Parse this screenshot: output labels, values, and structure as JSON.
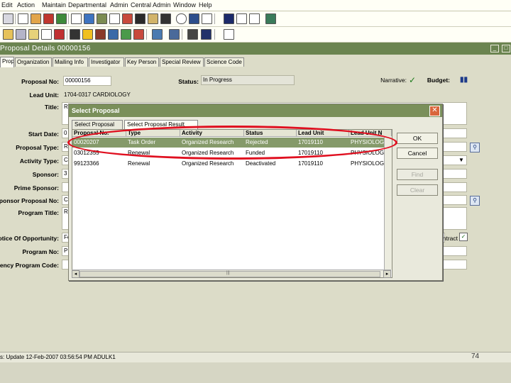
{
  "menu": [
    "Edit",
    "Action",
    "Maintain",
    "Departmental",
    "Admin",
    "Central Admin",
    "Window",
    "Help"
  ],
  "window": {
    "title": "Proposal Details  00000156"
  },
  "tabs": [
    "Proposal",
    "Organization",
    "Mailing Info",
    "Investigator",
    "Key Person",
    "Special Review",
    "Science Code"
  ],
  "form": {
    "proposal_no_label": "Proposal No:",
    "proposal_no": "00000156",
    "status_label": "Status:",
    "status": "In Progress",
    "narrative_label": "Narrative:",
    "budget_label": "Budget:",
    "lead_unit_label": "Lead Unit:",
    "lead_unit": "1704-0317 CARDIOLOGY",
    "title_label": "Title:",
    "title": "R",
    "start_date_label": "Start Date:",
    "start_date": "0",
    "proposal_type_label": "Proposal Type:",
    "proposal_type": "Ro",
    "activity_type_label": "Activity Type:",
    "activity_type": "Cl",
    "sponsor_label": "Sponsor:",
    "sponsor": "3",
    "prime_sponsor_label": "Prime Sponsor:",
    "sponsor_proposal_no_label": "Sponsor Proposal No:",
    "sponsor_proposal_no": "C",
    "program_title_label": "Program Title:",
    "program_title": "Re",
    "notice_label": "Notice Of Opportunity:",
    "notice": "Fe",
    "contract_label": "Contract",
    "program_no_label": "Program No:",
    "program_no": "P",
    "agency_code_label": "Agency Program Code:"
  },
  "dialog": {
    "title": "Select Proposal",
    "tabs": [
      "Select Proposal",
      "Select Proposal Result"
    ],
    "columns": [
      "Proposal No.",
      "Type",
      "Activity",
      "Status",
      "Lead Unit",
      "Lead Unit N"
    ],
    "rows": [
      [
        "00020207",
        "Task Order",
        "Organized Research",
        "Rejected",
        "17019110",
        "PHYSIOLOGY P"
      ],
      [
        "03012355",
        "Renewal",
        "Organized Research",
        "Funded",
        "17019110",
        "PHYSIOLOGY P"
      ],
      [
        "99123366",
        "Renewal",
        "Organized Research",
        "Deactivated",
        "17019110",
        "PHYSIOLOGY P"
      ]
    ],
    "buttons": {
      "ok": "OK",
      "cancel": "Cancel",
      "find": "Find",
      "clear": "Clear"
    }
  },
  "statusbar": {
    "text": "s: Update  12-Feb-2007 03:56:54 PM  ADULK1"
  },
  "page_number": "74",
  "colors": {
    "accent": "#6b8450",
    "selection": "#859a6a",
    "annotation": "#e01020"
  }
}
